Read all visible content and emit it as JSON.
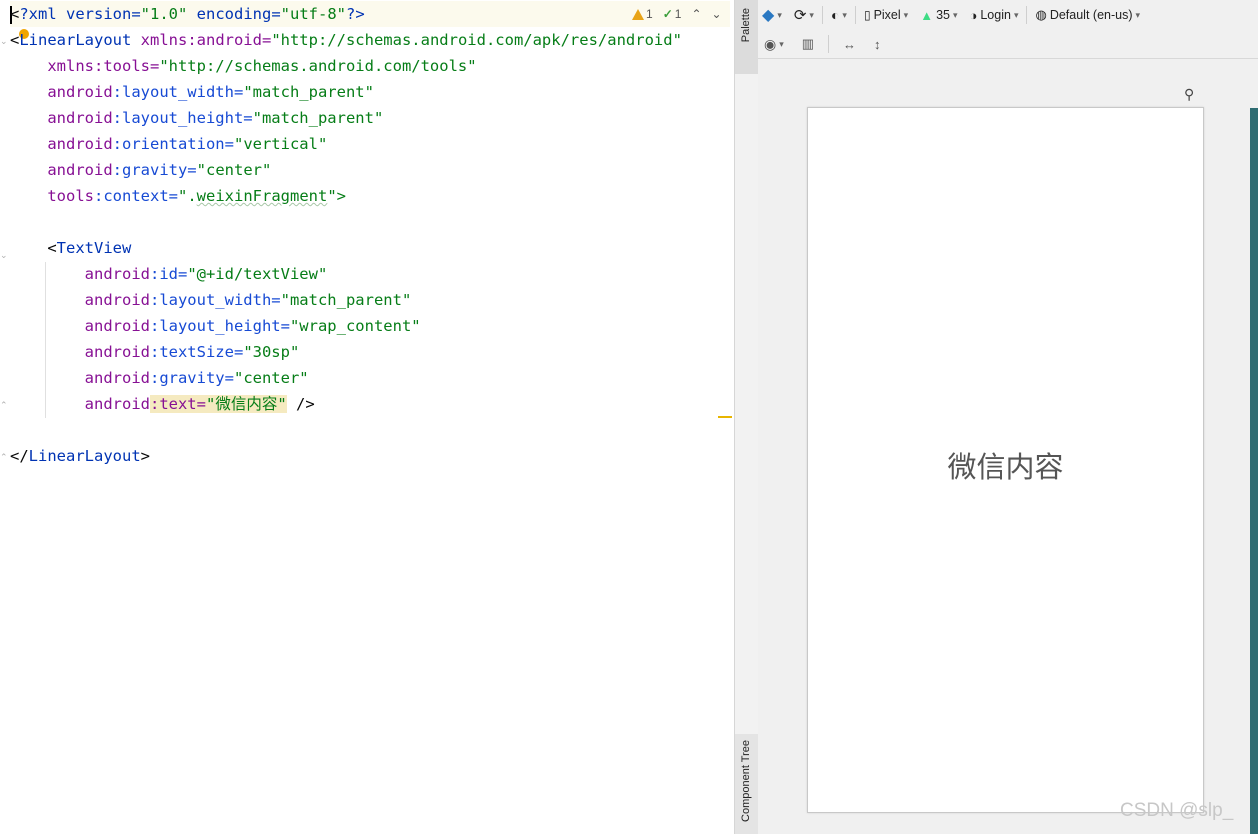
{
  "editor": {
    "lines": [
      [
        "<",
        "?xml version=",
        "\"1.0\"",
        " encoding=",
        "\"utf-8\"",
        "?>"
      ],
      [
        "<",
        "LinearLayout",
        " xmlns:android=",
        "\"http://schemas.android.com/apk/res/android\""
      ],
      [
        "    xmlns:tools=",
        "\"http://schemas.android.com/tools\""
      ],
      [
        "    android",
        ":layout_width=",
        "\"match_parent\""
      ],
      [
        "    android",
        ":layout_height=",
        "\"match_parent\""
      ],
      [
        "    android",
        ":orientation=",
        "\"vertical\""
      ],
      [
        "    android",
        ":gravity=",
        "\"center\""
      ],
      [
        "    tools",
        ":context=",
        "\".",
        "weixinFragment",
        "\">"
      ],
      [
        ""
      ],
      [
        "    <",
        "TextView"
      ],
      [
        "        android",
        ":id=",
        "\"@+id/textView\""
      ],
      [
        "        android",
        ":layout_width=",
        "\"match_parent\""
      ],
      [
        "        android",
        ":layout_height=",
        "\"wrap_content\""
      ],
      [
        "        android",
        ":textSize=",
        "\"30sp\""
      ],
      [
        "        android",
        ":gravity=",
        "\"center\""
      ],
      [
        "        android",
        ":text=",
        "\"微信内容\"",
        " />"
      ],
      [
        ""
      ],
      [
        "</",
        "LinearLayout",
        ">"
      ]
    ],
    "inspections": {
      "warnings": "1",
      "typos": "1"
    }
  },
  "stripe": {
    "palette": "Palette",
    "component_tree": "Component Tree"
  },
  "design": {
    "device": "Pixel",
    "api": "35",
    "theme": "Login",
    "locale": "Default (en-us)",
    "preview_text": "微信内容"
  },
  "watermark": "CSDN @slp_"
}
